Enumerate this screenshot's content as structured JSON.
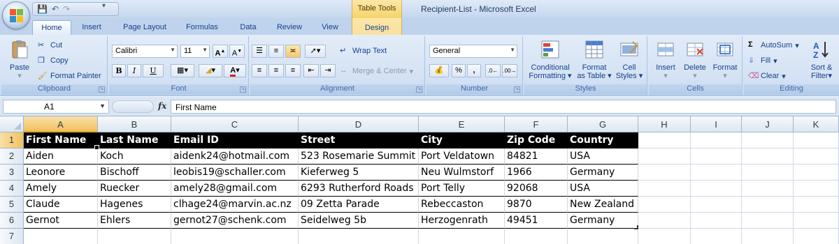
{
  "window": {
    "title": "Recipient-List - Microsoft Excel",
    "contextual_group": "Table Tools"
  },
  "tabs": [
    "Home",
    "Insert",
    "Page Layout",
    "Formulas",
    "Data",
    "Review",
    "View",
    "Design"
  ],
  "active_tab": "Home",
  "ribbon": {
    "clipboard": {
      "label": "Clipboard",
      "paste": "Paste",
      "cut": "Cut",
      "copy": "Copy",
      "format_painter": "Format Painter"
    },
    "font": {
      "label": "Font",
      "font_name": "Calibri",
      "font_size": "11",
      "bold": "B",
      "italic": "I",
      "underline": "U"
    },
    "alignment": {
      "label": "Alignment",
      "wrap_text": "Wrap Text",
      "merge_center": "Merge & Center"
    },
    "number": {
      "label": "Number",
      "format": "General",
      "percent": "%",
      "comma": ","
    },
    "styles": {
      "label": "Styles",
      "conditional": "Conditional",
      "conditional2": "Formatting",
      "format_as": "Format",
      "format_as2": "as Table",
      "cell": "Cell",
      "cell2": "Styles"
    },
    "cells": {
      "label": "Cells",
      "insert": "Insert",
      "delete": "Delete",
      "format": "Format"
    },
    "editing": {
      "label": "Editing",
      "autosum": "AutoSum",
      "fill": "Fill",
      "clear": "Clear",
      "sort": "Sort &",
      "sort2": "Filter"
    }
  },
  "formula_bar": {
    "name_box": "A1",
    "fx": "fx",
    "content": "First Name"
  },
  "columns": [
    "A",
    "B",
    "C",
    "D",
    "E",
    "F",
    "G",
    "H",
    "I",
    "J",
    "K"
  ],
  "rows": [
    "1",
    "2",
    "3",
    "4",
    "5",
    "6",
    "7"
  ],
  "table": {
    "headers": [
      "First Name",
      "Last Name",
      "Email ID",
      "Street",
      "City",
      "Zip Code",
      "Country"
    ],
    "rows": [
      [
        "Aiden",
        "Koch",
        "aidenk24@hotmail.com",
        "523 Rosemarie Summit",
        "Port Veldatown",
        "84821",
        "USA"
      ],
      [
        "Leonore",
        "Bischoff",
        "leobis19@schaller.com",
        "Kieferweg 5",
        "Neu Wulmstorf",
        "1966",
        "Germany"
      ],
      [
        "Amely",
        "Ruecker",
        "amely28@gmail.com",
        "6293 Rutherford Roads",
        "Port Telly",
        "92068",
        "USA"
      ],
      [
        "Claude",
        "Hagenes",
        "clhage24@marvin.ac.nz",
        "09 Zetta Parade",
        "Rebeccaston",
        "9870",
        "New Zealand"
      ],
      [
        "Gernot",
        "Ehlers",
        "gernot27@schenk.com",
        "Seidelweg 5b",
        "Herzogenrath",
        "49451",
        "Germany"
      ]
    ]
  },
  "colors": {
    "ribbon": "#d4e2f4",
    "selected_header": "#f1c15f",
    "table_header_bg": "#000000"
  }
}
